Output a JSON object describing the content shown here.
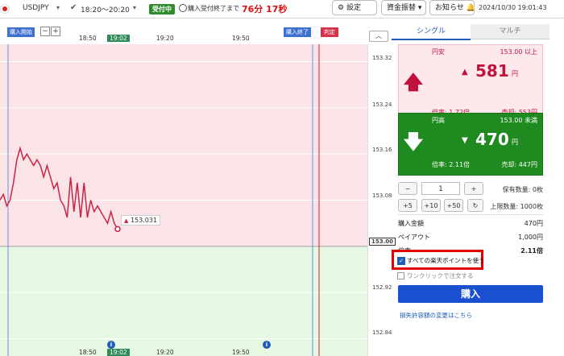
{
  "topbar": {
    "pair": "USDJPY",
    "time_range": "18:20〜20:20",
    "status_badge": "受付中",
    "deadline_label": "購入受付終了まで",
    "countdown": "76分 17秒",
    "settings_label": "設定",
    "funds_label": "資金振替",
    "notice_label": "お知らせ",
    "datetime": "2024/10/30  19:01:43"
  },
  "chart": {
    "start_label": "購入開始",
    "end_label": "購入終了",
    "judge_label": "判定",
    "minus_label": "−",
    "plus_label": "+",
    "x_ticks": [
      "18:50",
      "19:02",
      "19:20",
      "19:50"
    ],
    "y_ticks": [
      "153.32",
      "153.24",
      "153.16",
      "153.08",
      "153.00",
      "152.92",
      "152.84"
    ],
    "current_price": "153.031",
    "strike": "153.00",
    "colors": {
      "upper": "#fbe4e8",
      "lower": "#e6f8e2",
      "line": "#cc2244",
      "blueline": "#6a8fd8",
      "redline": "#cc2233"
    }
  },
  "chart_data": {
    "type": "line",
    "title": "",
    "xlabel": "",
    "ylabel": "",
    "ylim": [
      152.81,
      153.35
    ],
    "series": [
      {
        "values": [
          153.08,
          153.09,
          153.07,
          153.08,
          153.11,
          153.15,
          153.17,
          153.15,
          153.16,
          153.15,
          153.14,
          153.15,
          153.14,
          153.12,
          153.14,
          153.12,
          153.1,
          153.11,
          153.08,
          153.07,
          153.05,
          153.12,
          153.06,
          153.11,
          153.05,
          153.11,
          153.05,
          153.08,
          153.06,
          153.07,
          153.06,
          153.05,
          153.04,
          153.06,
          153.04,
          153.03
        ]
      }
    ]
  },
  "tabs": {
    "single": "シングル",
    "multi": "マルチ"
  },
  "up_card": {
    "title": "円安",
    "strike": "153.00 以上",
    "price": "581",
    "unit": "円",
    "rate": "倍率: 1.72倍",
    "sell": "売却: 553円"
  },
  "down_card": {
    "title": "円高",
    "strike": "153.00 未満",
    "price": "470",
    "unit": "円",
    "rate": "倍率: 2.11倍",
    "sell": "売却: 447円"
  },
  "qty": {
    "minus": "−",
    "value": "1",
    "plus": "+",
    "held": "保有数量: 0枚",
    "limit": "上限数量: 1000枚",
    "steps": [
      "+5",
      "+10",
      "+50"
    ]
  },
  "summary": {
    "amount_label": "購入金額",
    "amount": "470円",
    "payout_label": "ペイアウト",
    "payout": "1,000円",
    "rate_label": "倍率",
    "rate": "2.11倍"
  },
  "points_checkbox": "すべての楽天ポイントを使う",
  "one_click": "ワンクリックで注文する",
  "buy_button": "購入",
  "loss_link": "損失許容額の変更はこちら"
}
